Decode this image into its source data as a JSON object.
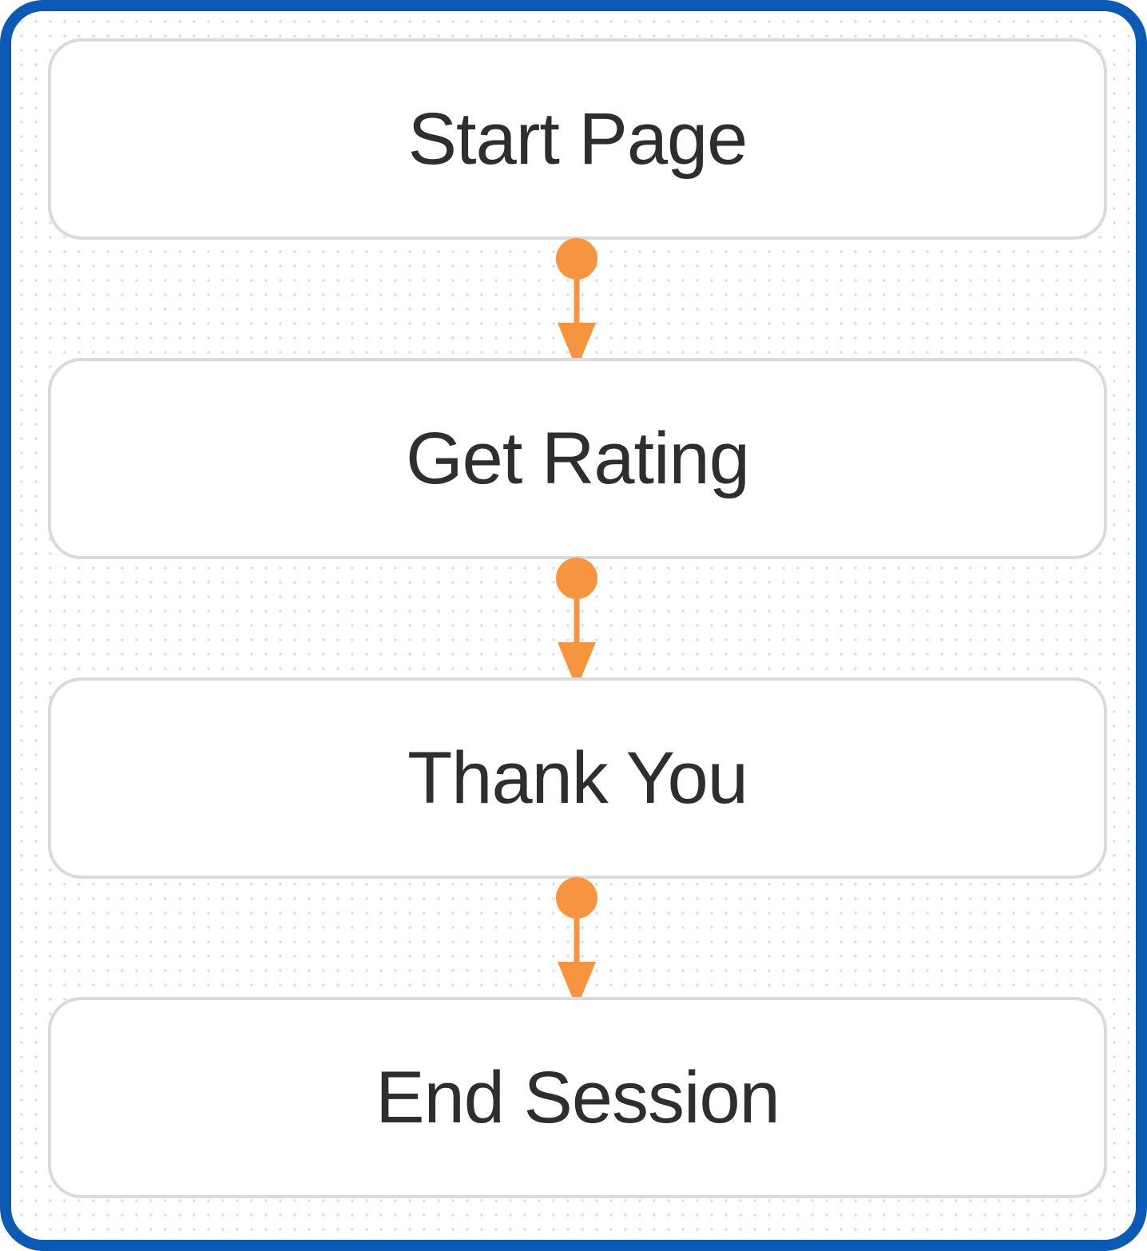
{
  "diagram": {
    "nodes": [
      {
        "id": "start-page",
        "label": "Start Page"
      },
      {
        "id": "get-rating",
        "label": "Get Rating"
      },
      {
        "id": "thank-you",
        "label": "Thank You"
      },
      {
        "id": "end-session",
        "label": "End Session"
      }
    ],
    "edges": [
      {
        "from": "start-page",
        "to": "get-rating"
      },
      {
        "from": "get-rating",
        "to": "thank-you"
      },
      {
        "from": "thank-you",
        "to": "end-session"
      }
    ],
    "colors": {
      "frame_border": "#0b5bb5",
      "connector": "#f79440",
      "node_border": "#d9dade",
      "label_text": "#2e2e30"
    }
  }
}
